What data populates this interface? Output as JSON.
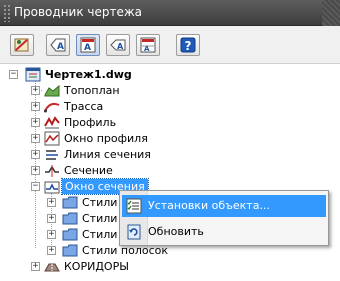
{
  "window": {
    "title": "Проводник чертежа"
  },
  "toolbar": {
    "buttons": [
      {
        "icon": "drawing-settings-icon"
      },
      {
        "icon": "label-icon"
      },
      {
        "icon": "label-style-icon"
      },
      {
        "icon": "label-arrow-icon"
      },
      {
        "icon": "label-table-icon"
      },
      {
        "icon": "help-icon",
        "glyph": "?"
      }
    ]
  },
  "tree": {
    "root": {
      "label": "Чертеж1.dwg",
      "expander": "−"
    },
    "items": [
      {
        "label": "Топоплан",
        "icon": "surface-icon",
        "expander": "+"
      },
      {
        "label": "Трасса",
        "icon": "alignment-icon",
        "expander": "+"
      },
      {
        "label": "Профиль",
        "icon": "profile-icon",
        "expander": "+"
      },
      {
        "label": "Окно профиля",
        "icon": "profile-view-icon",
        "expander": "+"
      },
      {
        "label": "Линия сечения",
        "icon": "sample-line-icon",
        "expander": "+"
      },
      {
        "label": "Сечение",
        "icon": "section-icon",
        "expander": "+"
      },
      {
        "label": "Окно сечения",
        "icon": "section-view-icon",
        "expander": "−",
        "selected": true
      },
      {
        "label": "Стили",
        "icon": "folder-icon",
        "expander": "+"
      },
      {
        "label": "Стили",
        "icon": "folder-icon",
        "expander": "+"
      },
      {
        "label": "Стили",
        "icon": "folder-icon",
        "expander": "+"
      },
      {
        "label": "Стили полосок",
        "icon": "folder-icon",
        "expander": "+"
      },
      {
        "label": "КОРИДОРЫ",
        "icon": "corridor-icon",
        "expander": "+"
      }
    ]
  },
  "context_menu": {
    "items": [
      {
        "label": "Установки объекта...",
        "icon": "object-settings-icon",
        "highlighted": true
      },
      {
        "label": "Обновить",
        "icon": "refresh-icon",
        "highlighted": false
      }
    ]
  },
  "colors": {
    "selection": "#3399ff",
    "titlebar": "#4a4a4a",
    "toolbar": "#f0f0f0",
    "folder": "#5b8fd9"
  }
}
